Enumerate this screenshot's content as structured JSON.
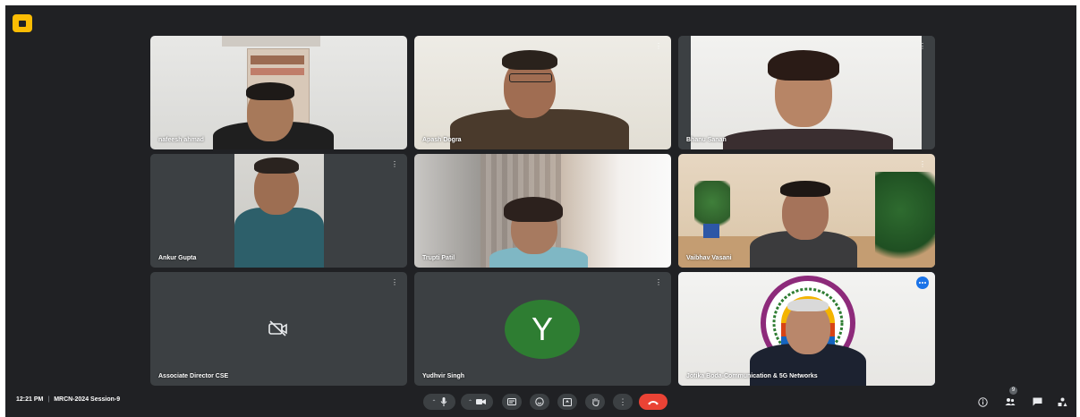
{
  "app": {
    "badge_icon": "meet-tab-icon"
  },
  "participants": [
    {
      "name": "nafeesh ahmad"
    },
    {
      "name": "Apash Dogra"
    },
    {
      "name": "Bhanu Sanan"
    },
    {
      "name": "Ankur Gupta"
    },
    {
      "name": "Trupti Patil"
    },
    {
      "name": "Vaibhav Vasani"
    },
    {
      "name": "Associate Director CSE",
      "camera": "off"
    },
    {
      "name": "Yudhvir Singh",
      "avatar_letter": "Y",
      "avatar_color": "#2e7d32"
    },
    {
      "name": "Jotika Boda-Communication & 5G Networks",
      "speaking": true
    }
  ],
  "bottom_bar": {
    "time": "12:21 PM",
    "separator": "|",
    "meeting_title": "MRCN-2024 Session-9",
    "controls": [
      "mic-icon",
      "camera-icon",
      "captions-icon",
      "emoji-icon",
      "present-icon",
      "raise-hand-icon",
      "more-options-icon",
      "end-call-icon"
    ],
    "people_count": "9",
    "right_icons": [
      "info-icon",
      "people-icon",
      "chat-icon",
      "activities-icon"
    ]
  },
  "colors": {
    "background": "#202124",
    "tile": "#3c4043",
    "end_call": "#ea4335",
    "active_outline": "#8ab4f8",
    "app_badge": "#fbbc04"
  }
}
